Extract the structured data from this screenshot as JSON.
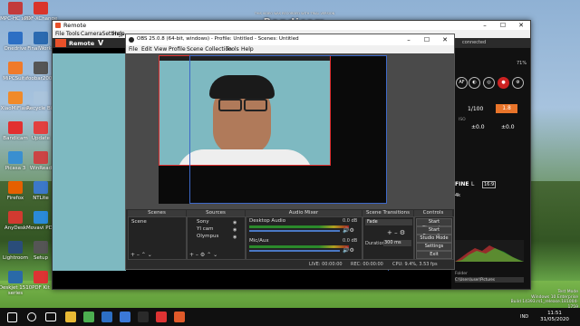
{
  "desktop": {
    "icons": [
      {
        "label": "MPC-HC x64",
        "color": "#c23b3b"
      },
      {
        "label": "PDF-XChange",
        "color": "#d9342b"
      },
      {
        "label": "Onedrive",
        "color": "#2d6fc4"
      },
      {
        "label": "FinalWorks",
        "color": "#2b6ab0"
      },
      {
        "label": "MiPCSuite",
        "color": "#f07a2a"
      },
      {
        "label": "foobar2000",
        "color": "#555555"
      },
      {
        "label": "XiaoMiFlash",
        "color": "#f08a2a"
      },
      {
        "label": "Recycle Bin",
        "color": "#aac4dc"
      },
      {
        "label": "Bandicam",
        "color": "#e23030"
      },
      {
        "label": "Update",
        "color": "#e24040"
      },
      {
        "label": "Picasa 3",
        "color": "#3a8fd0"
      },
      {
        "label": "WinRead",
        "color": "#c44"
      },
      {
        "label": "Firefox",
        "color": "#e66000"
      },
      {
        "label": "NTLite",
        "color": "#3c78c8"
      },
      {
        "label": "AnyDesk",
        "color": "#d13a30"
      },
      {
        "label": "Movavi PDF",
        "color": "#2a8ad8"
      },
      {
        "label": "Lightroom",
        "color": "#2a4d7a"
      },
      {
        "label": "Setup",
        "color": "#555"
      },
      {
        "label": "Deskjet 1510 series",
        "color": "#2a6aa8"
      },
      {
        "label": "PDF Kit",
        "color": "#d33"
      }
    ],
    "watermark_line1": "THIS VIDEO WAS RECORDED WITH TRIAL VERSION",
    "watermark_brand": "Bandicam",
    "watermark_line2": "BUY LIFETIME LICENSE NOW AT WWW.BANDICAM.COM",
    "activation_line1": "Test Mode",
    "activation_line2": "Windows 10 Enterprise",
    "activation_line3": "Build 14393.rs1_release.181004-1759"
  },
  "remote": {
    "title": "Remote",
    "menu": [
      "File",
      "Tools",
      "CameraSettings",
      "Help"
    ],
    "toolbar_title": "Remote",
    "status": "connected",
    "right_value": "71%",
    "exposure": "1/100",
    "fnumber": "1.8",
    "iso_label": "ISO",
    "ev1": "±0.0",
    "ev2": "±0.0",
    "quality_fine": "FINE",
    "quality_l": "L",
    "quality_ratio": "16:9",
    "scene": "4k",
    "histogram_label": "Histogram",
    "folder_label": "Folder",
    "folder_path": "C:\\Users\\user\\Pictures",
    "file_format_label": "File Format",
    "opt_auto": "Auto",
    "opt_manual": "Manual"
  },
  "obs": {
    "title": "OBS 25.0.8 (64-bit, windows) - Profile: Untitled - Scenes: Untitled",
    "menu": [
      "File",
      "Edit",
      "View",
      "Profile",
      "Scene Collection",
      "Tools",
      "Help"
    ],
    "docks": {
      "scenes": "Scenes",
      "sources": "Sources",
      "mixer": "Audio Mixer",
      "transitions": "Scene Transitions",
      "controls": "Controls"
    },
    "scenes": [
      "Scene"
    ],
    "sources": [
      "Sony",
      "YI cam",
      "Olympus"
    ],
    "mixer": [
      {
        "name": "Desktop Audio",
        "db": "0.0 dB"
      },
      {
        "name": "Mic/Aux",
        "db": "0.0 dB"
      }
    ],
    "transition": "Fade",
    "duration_label": "Duration",
    "duration_value": "300 ms",
    "controls": [
      "Start Streaming",
      "Start Recording",
      "Studio Mode",
      "Settings",
      "Exit"
    ],
    "status_live": "LIVE: 00:00:00",
    "status_rec": "REC: 00:00:00",
    "status_cpu": "CPU: 9.4%, 3.53 fps"
  },
  "taskbar": {
    "time": "11:51",
    "date": "31/05/2020",
    "lang": "IND",
    "apps": [
      {
        "name": "start",
        "color": "#ffffff"
      },
      {
        "name": "search",
        "color": "#ffffff"
      },
      {
        "name": "task-view",
        "color": "#ffffff"
      },
      {
        "name": "explorer",
        "color": "#e8b935"
      },
      {
        "name": "chrome",
        "color": "#4caf50"
      },
      {
        "name": "mail",
        "color": "#2d6fc4"
      },
      {
        "name": "store",
        "color": "#3b78d8"
      },
      {
        "name": "obs",
        "color": "#2a2a2a"
      },
      {
        "name": "remote",
        "color": "#d33"
      },
      {
        "name": "bandicam",
        "color": "#e05a2a"
      }
    ]
  }
}
